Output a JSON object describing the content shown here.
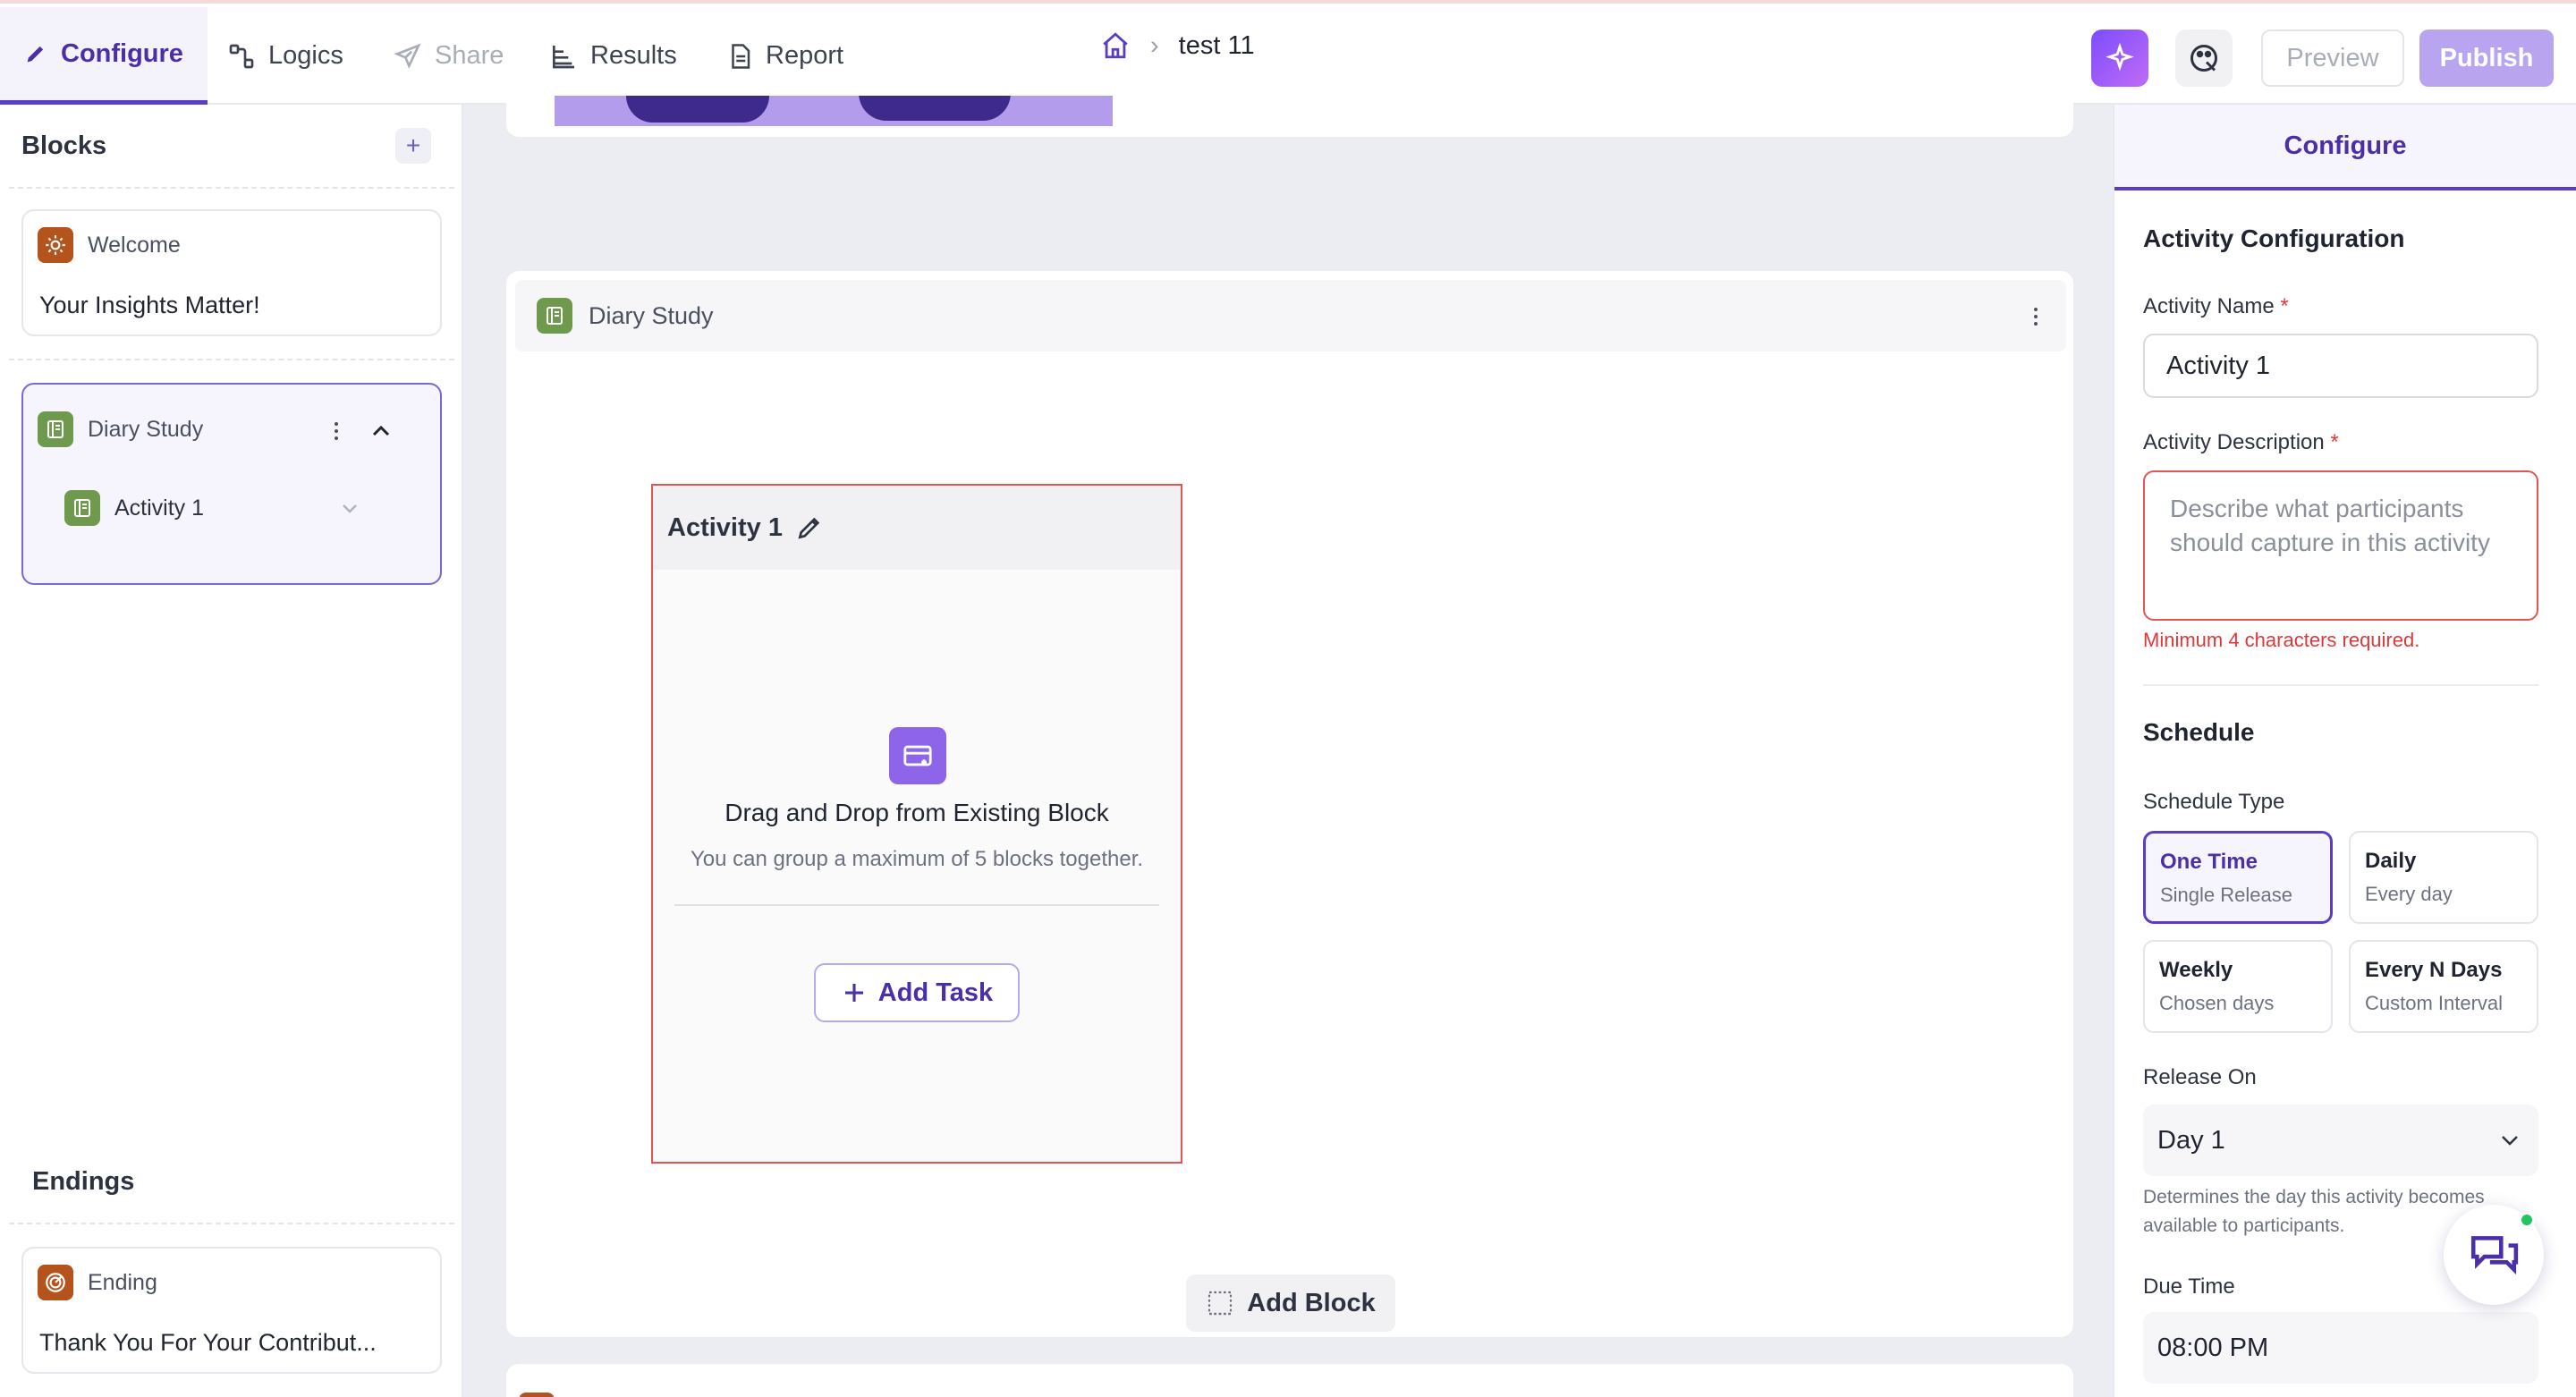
{
  "nav": {
    "tabs": [
      {
        "label": "Configure",
        "icon": "pencil-icon",
        "state": "active"
      },
      {
        "label": "Logics",
        "icon": "logic-nodes-icon",
        "state": "normal"
      },
      {
        "label": "Share",
        "icon": "send-icon",
        "state": "disabled"
      },
      {
        "label": "Results",
        "icon": "bar-chart-icon",
        "state": "normal"
      },
      {
        "label": "Report",
        "icon": "document-icon",
        "state": "normal"
      }
    ],
    "breadcrumb": {
      "home_icon": "home-icon",
      "separator": "›",
      "current": "test 11"
    },
    "preview_label": "Preview",
    "publish_label": "Publish"
  },
  "sidebar": {
    "blocks_title": "Blocks",
    "add_label": "+",
    "welcome": {
      "type": "Welcome",
      "title": "Your Insights Matter!"
    },
    "diary": {
      "type": "Diary Study",
      "children": [
        {
          "label": "Activity 1"
        }
      ]
    },
    "endings_title": "Endings",
    "ending": {
      "type": "Ending",
      "title": "Thank You For Your Contribut..."
    }
  },
  "canvas": {
    "diary_block_title": "Diary Study",
    "activity": {
      "title": "Activity 1",
      "drop_title": "Drag and Drop from Existing Block",
      "drop_hint": "You can group a maximum of 5 blocks together.",
      "add_task_label": "Add Task"
    },
    "add_block_label": "Add Block"
  },
  "panel": {
    "tab": "Configure",
    "section_title": "Activity Configuration",
    "name_label": "Activity Name",
    "name_value": "Activity 1",
    "desc_label": "Activity Description",
    "desc_placeholder": "Describe what participants should capture in this activity",
    "desc_error": "Minimum 4 characters required.",
    "schedule_title": "Schedule",
    "schedule_type_label": "Schedule Type",
    "schedule_options": [
      {
        "title": "One Time",
        "sub": "Single Release",
        "selected": true
      },
      {
        "title": "Daily",
        "sub": "Every day",
        "selected": false
      },
      {
        "title": "Weekly",
        "sub": "Chosen days",
        "selected": false
      },
      {
        "title": "Every N Days",
        "sub": "Custom Interval",
        "selected": false
      }
    ],
    "release_label": "Release On",
    "release_value": "Day 1",
    "release_help": "Determines the day this activity becomes available to participants.",
    "due_label": "Due Time",
    "due_value": "08:00 PM"
  },
  "colors": {
    "accent": "#5b3cc4",
    "error": "#e03838",
    "publish_bg": "#b9a4ef",
    "welcome_icon": "#b4531c",
    "diary_icon": "#6f9a4e"
  }
}
